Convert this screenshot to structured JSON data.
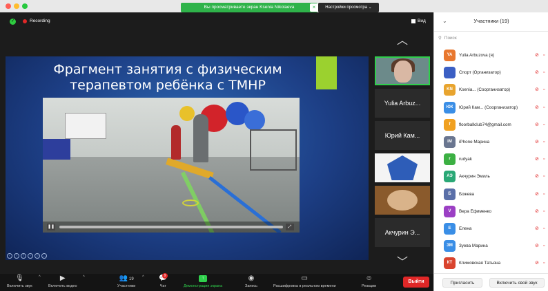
{
  "banner": {
    "text": "Вы просматриваете экран Ksenia Nikolaeva",
    "close": "×",
    "view_options": "Настройки просмотра ⌄"
  },
  "top": {
    "recording": "Recording",
    "view": "Вид"
  },
  "slide": {
    "title_line1": "Фрагмент занятия с физическим",
    "title_line2": "терапевтом ребёнка с ТМНР"
  },
  "gallery": {
    "up": "︿",
    "down": "﹀",
    "tiles": [
      "Yulia Arbuz...",
      "Юрий Кам...",
      "Акчурин Э..."
    ]
  },
  "controls": {
    "unmute": "Включить звук",
    "start_video": "Включить видео",
    "participants": "Участники",
    "participants_count": "19",
    "chat": "Чат",
    "chat_badge": "9",
    "share": "Демонстрация экрана",
    "record": "Запись",
    "transcript": "Расшифровка в реальном времени",
    "reactions": "Реакции",
    "leave": "Выйти"
  },
  "panel": {
    "title": "Участники (19)",
    "search_placeholder": "Поиск",
    "participants": [
      {
        "initials": "YA",
        "name": "Yulia Arbuzova (я)",
        "color": "#e8772e"
      },
      {
        "initials": "",
        "name": "Спорт (Организатор)",
        "color": "#3b5fc4"
      },
      {
        "initials": "KN",
        "name": "Ksenia... (Соорганизатор)",
        "color": "#e8a42e"
      },
      {
        "initials": "ЮК",
        "name": "Юрий Кам... (Соорганизатор)",
        "color": "#3a8ee6"
      },
      {
        "initials": "f",
        "name": "floorballclub74@gmail.com",
        "color": "#f0a020"
      },
      {
        "initials": "iM",
        "name": "iPhone Марина",
        "color": "#6a7690"
      },
      {
        "initials": "r",
        "name": "rudyak",
        "color": "#3cb043"
      },
      {
        "initials": "АЭ",
        "name": "Акчурин Эмиль",
        "color": "#2aa876"
      },
      {
        "initials": "Б",
        "name": "Божева",
        "color": "#5a6fa8"
      },
      {
        "initials": "V",
        "name": "Вера Ефименко",
        "color": "#9b3fc4"
      },
      {
        "initials": "Е",
        "name": "Елена",
        "color": "#3a8ee6"
      },
      {
        "initials": "ЗМ",
        "name": "Зуева Марина",
        "color": "#3a8ee6"
      },
      {
        "initials": "КТ",
        "name": "Климовская Татьяна",
        "color": "#d9442e"
      }
    ],
    "invite": "Пригласить",
    "unmute_me": "Включить свой звук"
  }
}
